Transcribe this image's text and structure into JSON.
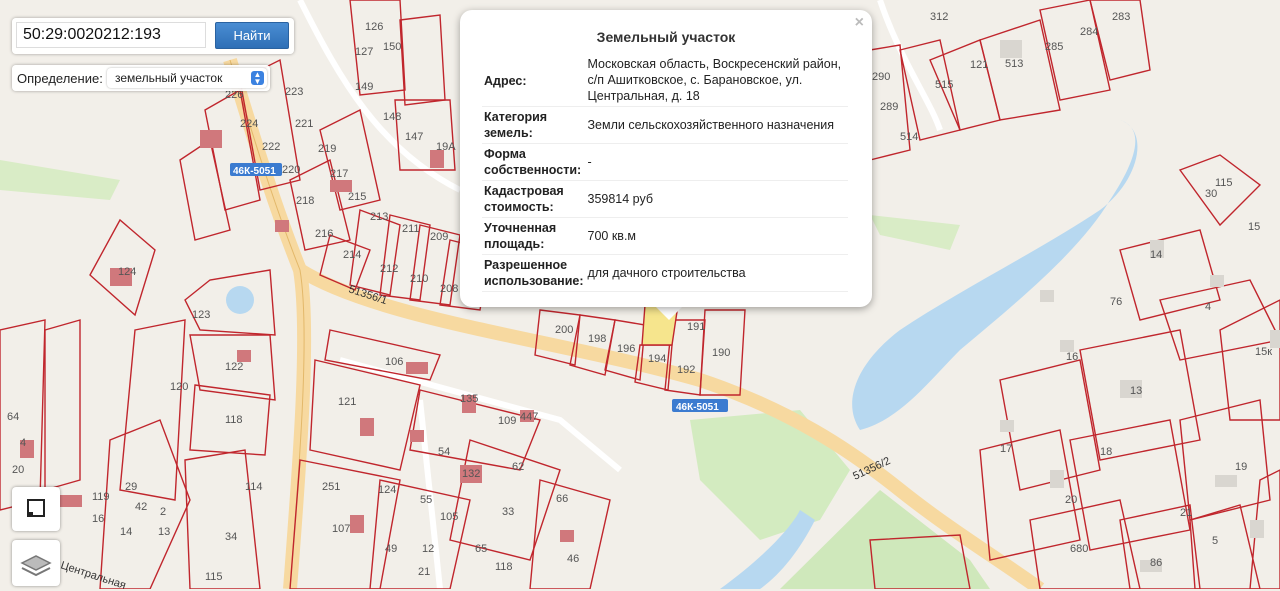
{
  "search": {
    "value": "50:29:0020212:193",
    "button_label": "Найти"
  },
  "definition": {
    "label": "Определение:",
    "selected": "земельный участок"
  },
  "controls": {
    "fullscreen_icon": "frame-icon",
    "layers_icon": "layers-icon"
  },
  "popup": {
    "title": "Земельный участок",
    "close": "×",
    "rows": [
      {
        "key": "Адрес:",
        "value": "Московская область, Воскресенский район, с/п Ашитковское, с. Барановское, ул. Центральная, д. 18"
      },
      {
        "key": "Категория земель:",
        "value": "Земли сельскохозяйственного назначения"
      },
      {
        "key": "Форма собственности:",
        "value": "-"
      },
      {
        "key": "Кадастровая стоимость:",
        "value": "359814 руб"
      },
      {
        "key": "Уточненная площадь:",
        "value": "700 кв.м"
      },
      {
        "key": "Разрешенное использование:",
        "value": "для дачного строительства"
      }
    ]
  },
  "map": {
    "roads": {
      "shield1": "46К-5051",
      "shield2": "46К-5051",
      "street1": "51356/1",
      "street2": "51356/2",
      "street3": "Центральная"
    },
    "labels": [
      "124",
      "123",
      "122",
      "118",
      "120",
      "121",
      "106",
      "135",
      "109",
      "447",
      "54",
      "132",
      "62",
      "33",
      "66",
      "46",
      "251",
      "107",
      "34",
      "115",
      "114",
      "29",
      "42",
      "2",
      "13",
      "119",
      "16",
      "14",
      "4",
      "20",
      "64",
      "55",
      "105",
      "65",
      "118",
      "21",
      "49",
      "12",
      "124",
      "200",
      "198",
      "196",
      "194",
      "192",
      "190",
      "191",
      "214",
      "212",
      "210",
      "208",
      "216",
      "218",
      "220",
      "222",
      "224",
      "226",
      "223",
      "221",
      "219",
      "217",
      "215",
      "213",
      "211",
      "209",
      "312",
      "513",
      "515",
      "285",
      "284",
      "283",
      "514",
      "289",
      "290",
      "115",
      "30",
      "15",
      "14",
      "16",
      "13",
      "17",
      "18",
      "20",
      "21",
      "19",
      "86",
      "5",
      "4",
      "15к",
      "76",
      "121",
      "126",
      "127",
      "150",
      "149",
      "148",
      "147",
      "19А",
      "680"
    ]
  }
}
